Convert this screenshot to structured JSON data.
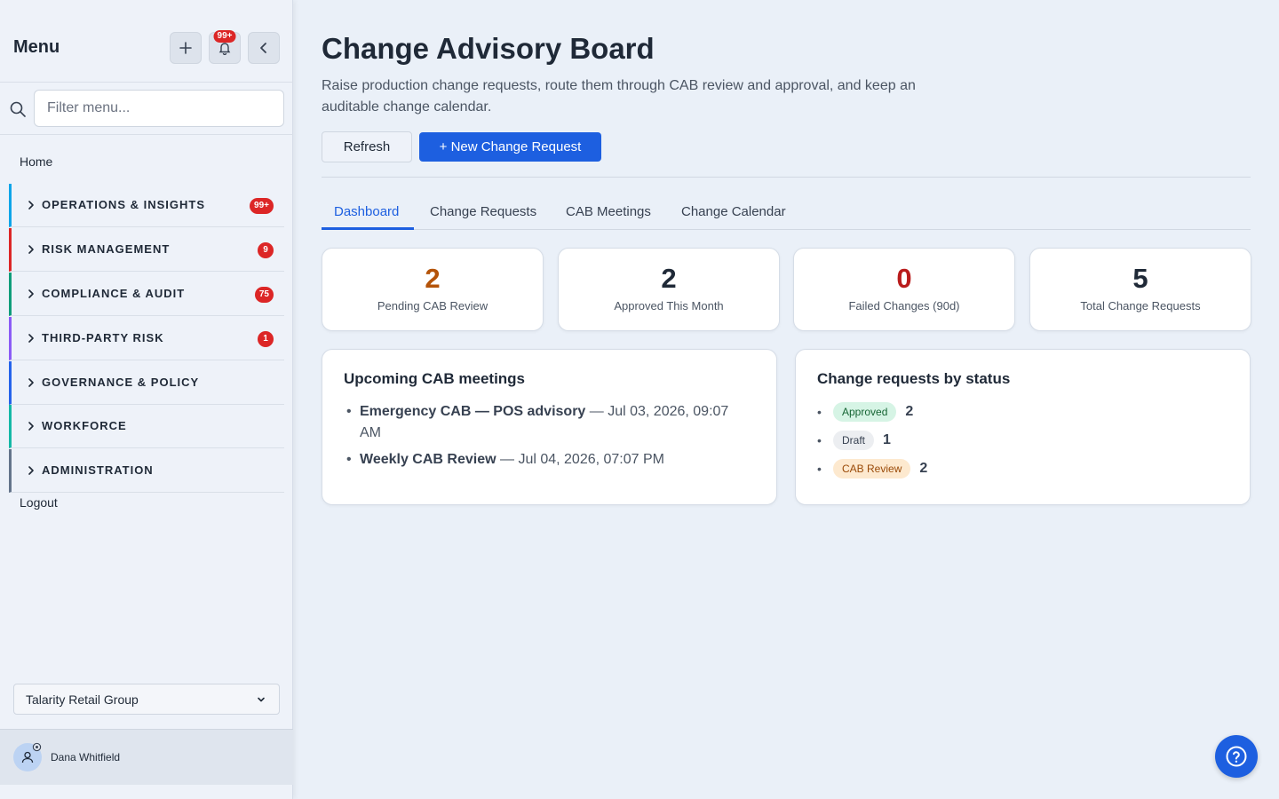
{
  "sidebar": {
    "title": "Menu",
    "notifications_badge": "99+",
    "filter_placeholder": "Filter menu...",
    "home_label": "Home",
    "sections": [
      {
        "label": "OPERATIONS & INSIGHTS",
        "count": "99+",
        "color": "#0ea5e9"
      },
      {
        "label": "RISK MANAGEMENT",
        "count": "9",
        "color": "#dc2626"
      },
      {
        "label": "COMPLIANCE & AUDIT",
        "count": "75",
        "color": "#0f9d7a"
      },
      {
        "label": "THIRD-PARTY RISK",
        "count": "1",
        "color": "#8b5cf6"
      },
      {
        "label": "GOVERNANCE & POLICY",
        "count": "",
        "color": "#2563eb"
      },
      {
        "label": "WORKFORCE",
        "count": "",
        "color": "#14b8a6"
      },
      {
        "label": "ADMINISTRATION",
        "count": "",
        "color": "#64748b"
      }
    ],
    "logout_label": "Logout",
    "org_selected": "Talarity Retail Group",
    "user_name": "Dana Whitfield"
  },
  "header": {
    "title": "Change Advisory Board",
    "description": "Raise production change requests, route them through CAB review and approval, and keep an auditable change calendar.",
    "refresh_label": "Refresh",
    "new_label": "+ New Change Request"
  },
  "tabs": [
    {
      "label": "Dashboard"
    },
    {
      "label": "Change Requests"
    },
    {
      "label": "CAB Meetings"
    },
    {
      "label": "Change Calendar"
    }
  ],
  "stats": [
    {
      "value": "2",
      "label": "Pending CAB Review",
      "color": "#b45309"
    },
    {
      "value": "2",
      "label": "Approved This Month",
      "color": "#1f2937"
    },
    {
      "value": "0",
      "label": "Failed Changes (90d)",
      "color": "#b91c1c"
    },
    {
      "value": "5",
      "label": "Total Change Requests",
      "color": "#1f2937"
    }
  ],
  "meetings_panel": {
    "title": "Upcoming CAB meetings",
    "items": [
      {
        "name": "Emergency CAB — POS advisory",
        "when": " — Jul 03, 2026, 09:07 AM"
      },
      {
        "name": "Weekly CAB Review",
        "when": " — Jul 04, 2026, 07:07 PM"
      }
    ]
  },
  "status_panel": {
    "title": "Change requests by status",
    "items": [
      {
        "status": "Approved",
        "count": "2"
      },
      {
        "status": "Draft",
        "count": "1"
      },
      {
        "status": "CAB Review",
        "count": "2"
      }
    ]
  },
  "icons": {
    "add": "plus-icon",
    "notifications": "bell-icon",
    "collapse": "chevron-left-icon",
    "search": "search-icon",
    "help": "help-circle-icon"
  }
}
